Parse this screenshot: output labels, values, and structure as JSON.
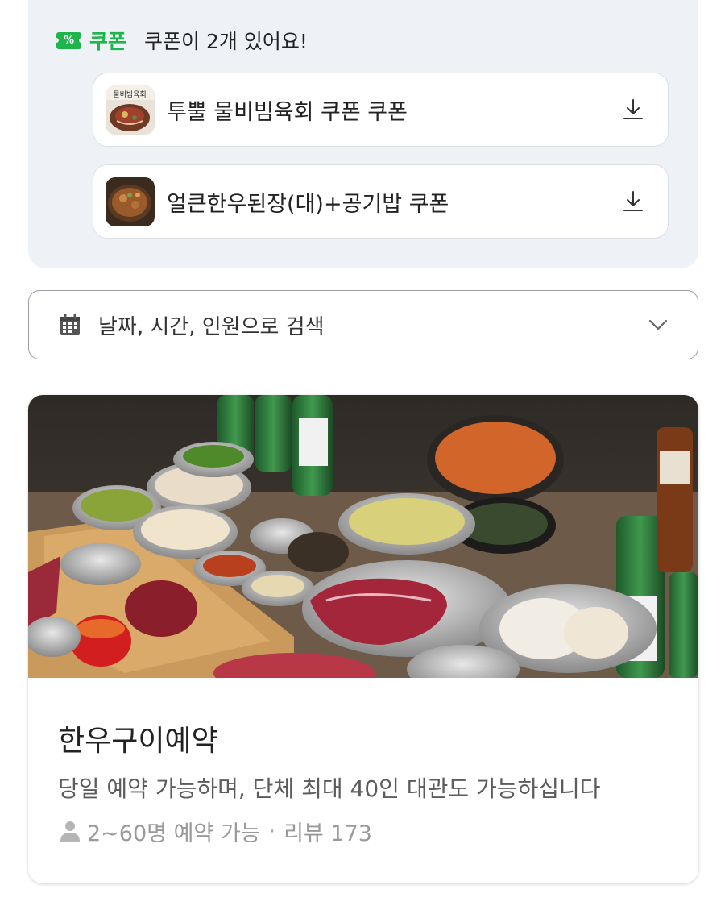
{
  "coupon": {
    "badge": "%",
    "tag": "쿠폰",
    "count_text": "쿠폰이 2개 있어요!",
    "items": [
      {
        "name": "투뿔 물비빔육회 쿠폰 쿠폰",
        "thumb_icon": "yukhoe-thumbnail",
        "download_icon": "download-icon"
      },
      {
        "name": "얼큰한우된장(대)+공기밥 쿠폰",
        "thumb_icon": "stew-thumbnail",
        "download_icon": "download-icon"
      }
    ]
  },
  "search": {
    "label": "날짜, 시간, 인원으로 검색",
    "icon": "calendar-icon",
    "chevron": "chevron-down-icon"
  },
  "card": {
    "image": "korean-bbq-table-photo",
    "title": "한우구이예약",
    "description": "당일 예약 가능하며, 단체 최대 40인 대관도 가능하십니다",
    "capacity": "2~60명 예약 가능",
    "separator": "·",
    "reviews": "리뷰 173"
  },
  "colors": {
    "accent": "#1eb54a",
    "panel": "#eef1f6"
  }
}
